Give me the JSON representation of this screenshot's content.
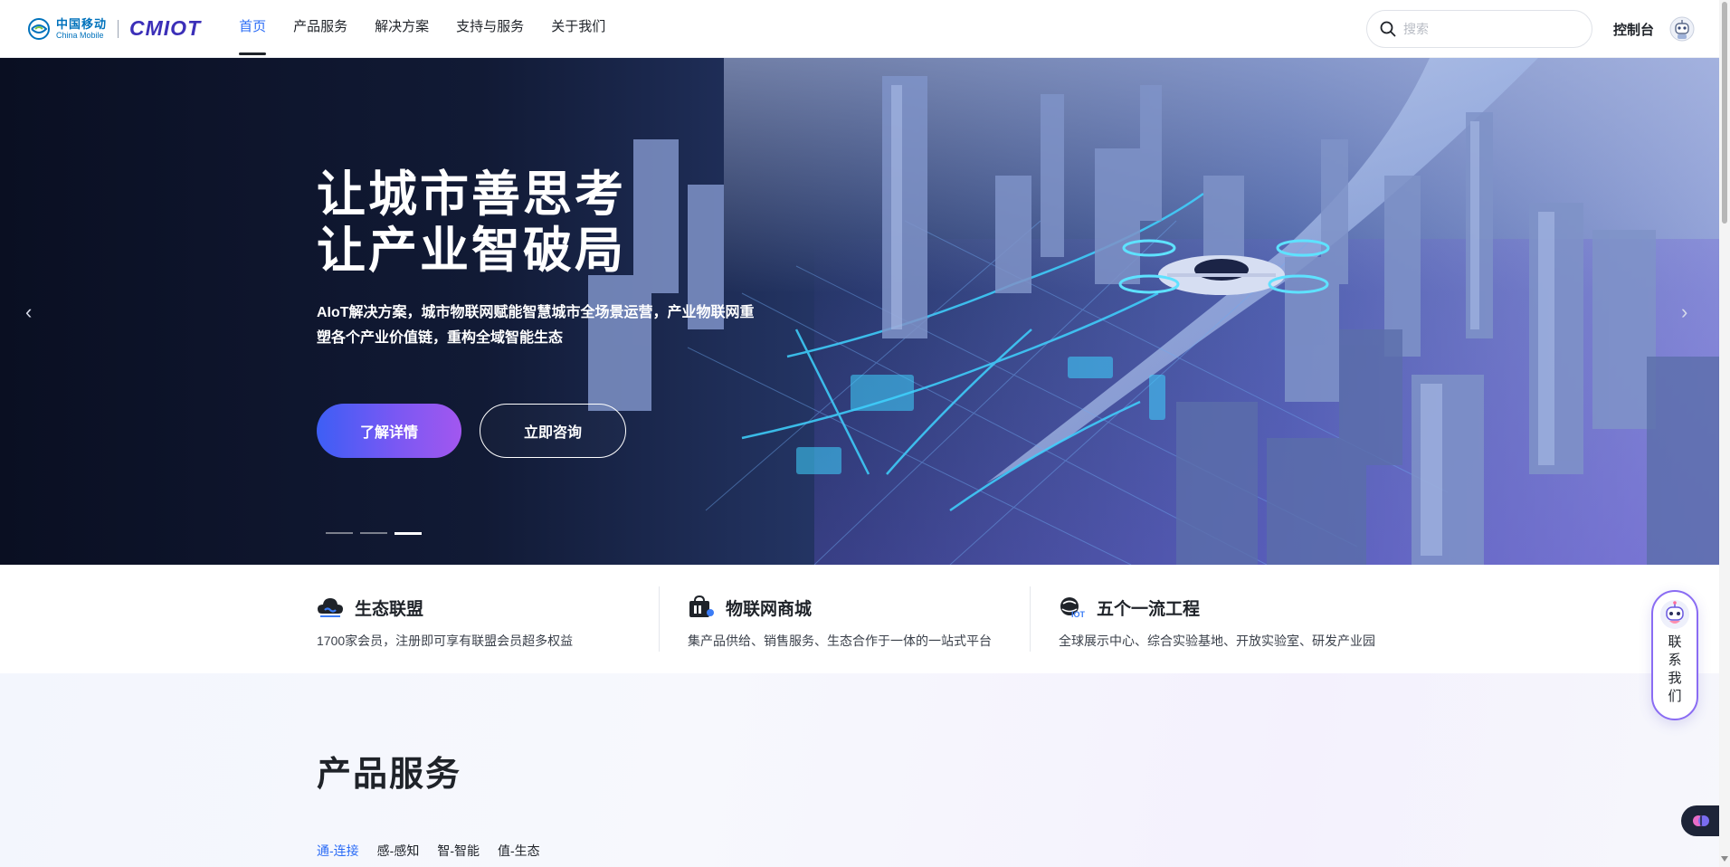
{
  "header": {
    "brand_cn": "中国移动",
    "brand_en": "China Mobile",
    "product_logo": "CMIOT",
    "nav": [
      {
        "label": "首页",
        "active": true
      },
      {
        "label": "产品服务"
      },
      {
        "label": "解决方案"
      },
      {
        "label": "支持与服务"
      },
      {
        "label": "关于我们"
      }
    ],
    "search_placeholder": "搜索",
    "console_label": "控制台",
    "icons": {
      "search": "search-icon",
      "avatar": "robot-avatar-icon"
    }
  },
  "banner": {
    "title_line1": "让城市善思考",
    "title_line2": "让产业智破局",
    "description": "AIoT解决方案，城市物联网赋能智慧城市全场景运营，产业物联网重塑各个产业价值链，重构全域智能生态",
    "primary_button": "了解详情",
    "secondary_button": "立即咨询",
    "slides_total": 3,
    "active_slide": 3,
    "prev_icon": "‹",
    "next_icon": "›"
  },
  "features": [
    {
      "title": "生态联盟",
      "desc": "1700家会员，注册即可享有联盟会员超多权益",
      "icon": "cloud-handshake-icon"
    },
    {
      "title": "物联网商城",
      "desc": "集产品供给、销售服务、生态合作于一体的一站式平台",
      "icon": "shopping-bag-icon"
    },
    {
      "title": "五个一流工程",
      "desc": "全球展示中心、综合实验基地、开放实验室、研发产业园",
      "icon": "iot-globe-icon"
    }
  ],
  "products": {
    "title": "产品服务",
    "tabs": [
      {
        "label": "通-连接",
        "active": true
      },
      {
        "label": "感-感知"
      },
      {
        "label": "智-智能"
      },
      {
        "label": "值-生态"
      }
    ]
  },
  "float": {
    "contact_label": "联系我们"
  },
  "colors": {
    "accent": "#2b6cf6",
    "brand_purple": "#3b2fb8",
    "button_gradient_start": "#3d5ef5",
    "button_gradient_end": "#a257ef",
    "banner_dark": "#0b1226"
  }
}
